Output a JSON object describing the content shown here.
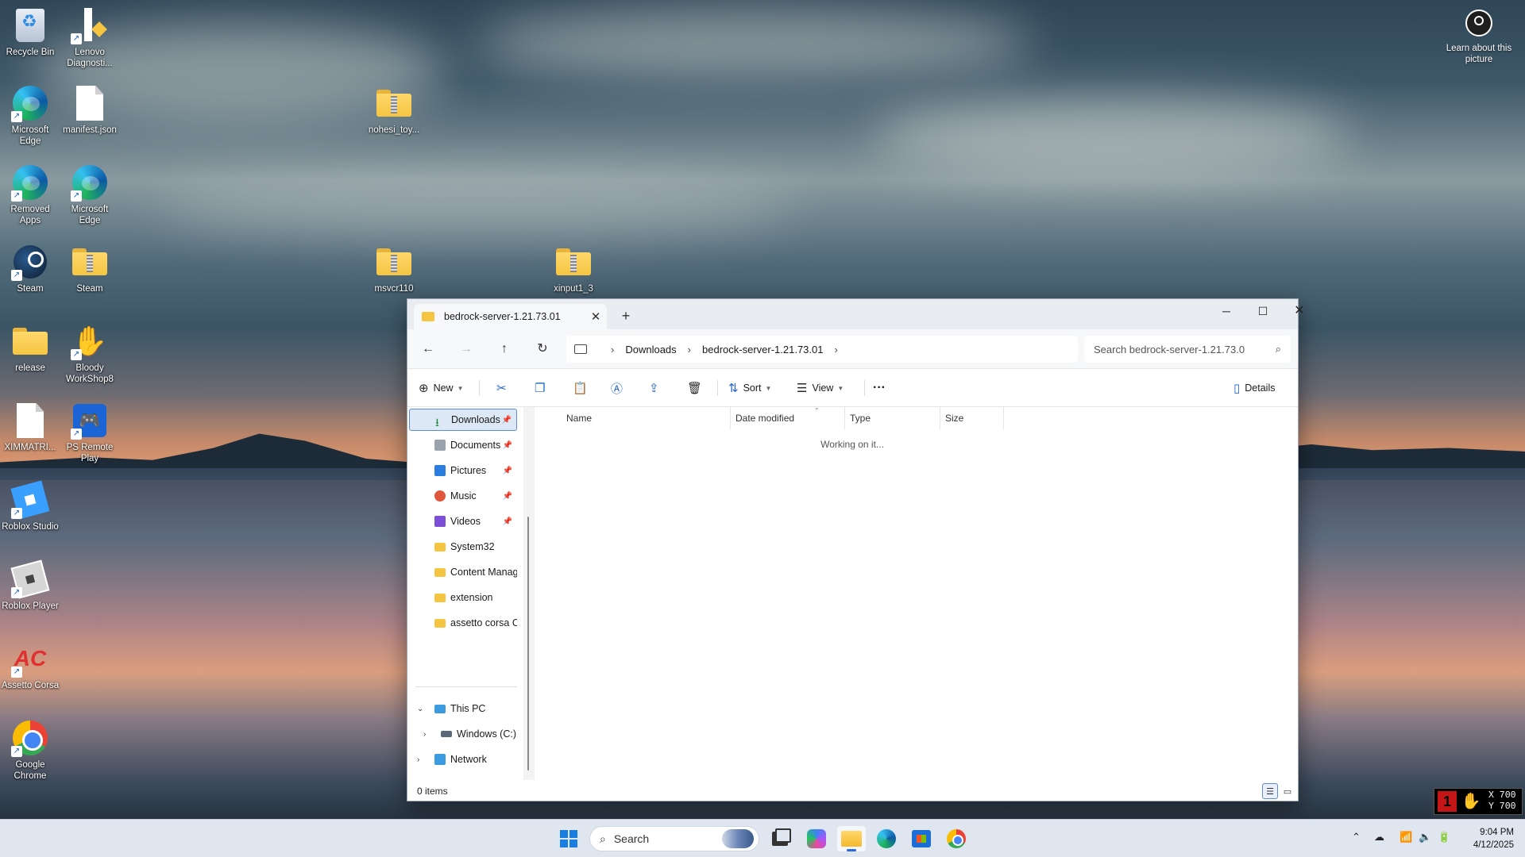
{
  "desktop": {
    "icons": [
      {
        "label": "Recycle Bin"
      },
      {
        "label": "Lenovo Diagnosti..."
      },
      {
        "label": "Microsoft Edge"
      },
      {
        "label": "manifest.json"
      },
      {
        "label": "Removed Apps"
      },
      {
        "label": "Microsoft Edge"
      },
      {
        "label": "Steam"
      },
      {
        "label": "Steam"
      },
      {
        "label": "release"
      },
      {
        "label": "Bloody WorkShop8"
      },
      {
        "label": "XIMMATRI..."
      },
      {
        "label": "PS Remote Play"
      },
      {
        "label": "Roblox Studio"
      },
      {
        "label": "Roblox Player"
      },
      {
        "label": "Assetto Corsa"
      },
      {
        "label": "Google Chrome"
      },
      {
        "label": "nohesi_toy..."
      },
      {
        "label": "msvcr110"
      },
      {
        "label": "xinput1_3"
      }
    ],
    "learn_label": "Learn about this picture"
  },
  "explorer": {
    "tab_title": "bedrock-server-1.21.73.01",
    "breadcrumb": [
      "Downloads",
      "bedrock-server-1.21.73.01"
    ],
    "search_placeholder": "Search bedrock-server-1.21.73.0",
    "commands": {
      "new": "New",
      "sort": "Sort",
      "view": "View",
      "more": "···",
      "details": "Details"
    },
    "nav_quick": [
      {
        "label": "Downloads",
        "pinned": true
      },
      {
        "label": "Documents",
        "pinned": true
      },
      {
        "label": "Pictures",
        "pinned": true
      },
      {
        "label": "Music",
        "pinned": true
      },
      {
        "label": "Videos",
        "pinned": true
      },
      {
        "label": "System32",
        "pinned": false
      },
      {
        "label": "Content Manag",
        "pinned": false
      },
      {
        "label": "extension",
        "pinned": false
      },
      {
        "label": "assetto corsa OC",
        "pinned": false
      }
    ],
    "nav_tree": [
      {
        "label": "This PC"
      },
      {
        "label": "Windows (C:)"
      },
      {
        "label": "Network"
      }
    ],
    "columns": [
      "Name",
      "Date modified",
      "Type",
      "Size"
    ],
    "loading_text": "Working on it...",
    "status_count": "0 items"
  },
  "overlay": {
    "x": "X 700",
    "y": "Y 700"
  },
  "taskbar": {
    "search_label": "Search",
    "time": "9:04 PM",
    "date": "4/12/2025"
  },
  "colors": {
    "accent": "#2b69d6",
    "folder": "#f5c542",
    "selection": "#dce8f6"
  }
}
